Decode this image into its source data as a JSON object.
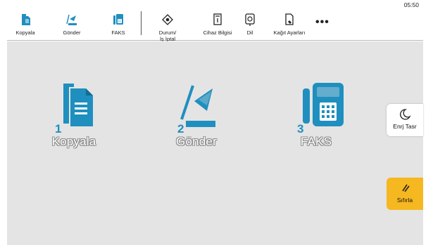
{
  "clock": "05:50",
  "toolbar": {
    "items": [
      {
        "label": "Kopyala"
      },
      {
        "label": "Gönder"
      },
      {
        "label": "FAKS"
      },
      {
        "label_line1": "Durum/",
        "label_line2": "İş İptal"
      },
      {
        "label": "Cihaz Bilgisi"
      },
      {
        "label": "Dil"
      },
      {
        "label": "Kağıt Ayarları"
      }
    ],
    "more": "•••"
  },
  "apps": [
    {
      "number": "1",
      "label": "Kopyala"
    },
    {
      "number": "2",
      "label": "Gönder"
    },
    {
      "number": "3",
      "label": "FAKS"
    }
  ],
  "side": {
    "energy_label": "Enrj Tasr",
    "reset_label": "Sıfırla"
  },
  "colors": {
    "accent": "#1f8fbf",
    "workarea": "#e4e4e4",
    "reset": "#f5b820"
  }
}
